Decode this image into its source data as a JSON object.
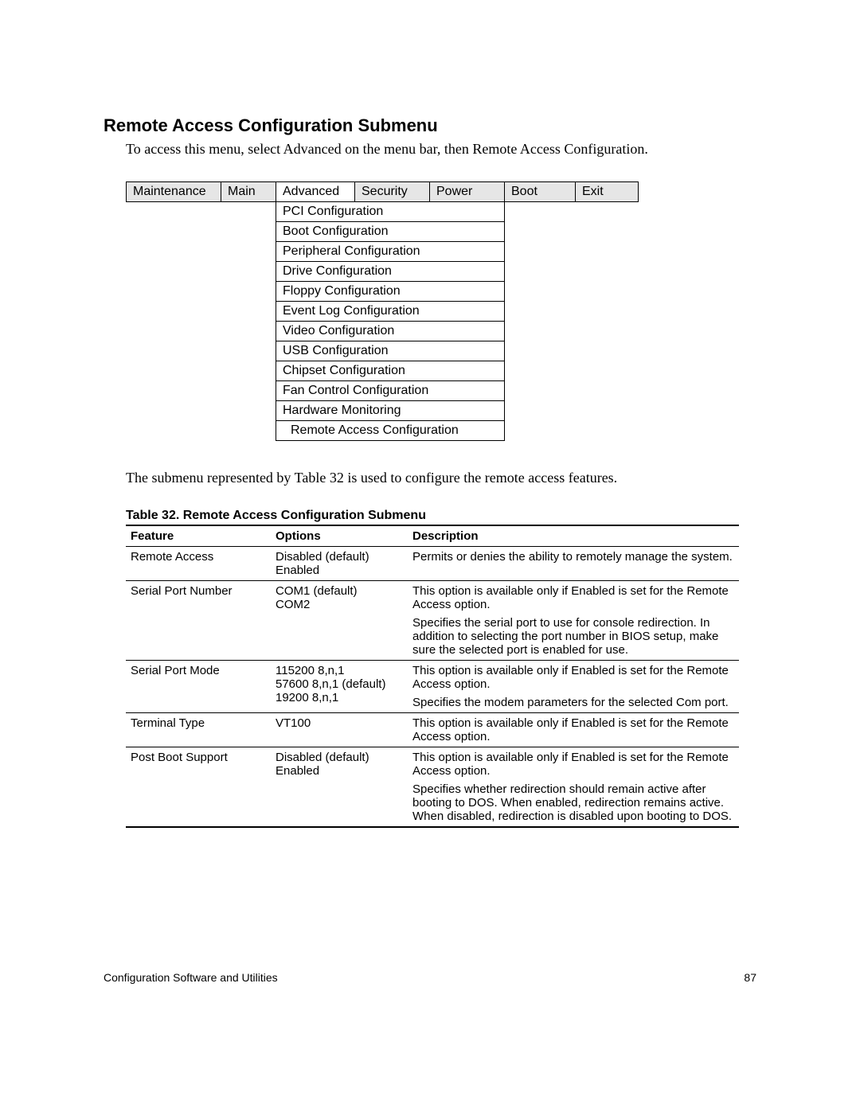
{
  "heading": "Remote Access Configuration Submenu",
  "intro": "To access this menu, select Advanced on the menu bar, then Remote Access Configuration.",
  "menu_tabs": [
    "Maintenance",
    "Main",
    "Advanced",
    "Security",
    "Power",
    "Boot",
    "Exit"
  ],
  "submenu_items": [
    "PCI Configuration",
    "Boot Configuration",
    "Peripheral Configuration",
    "Drive Configuration",
    "Floppy Configuration",
    "Event Log Configuration",
    "Video Configuration",
    "USB Configuration",
    "Chipset Configuration",
    "Fan Control Configuration",
    "Hardware Monitoring",
    "Remote Access Configuration"
  ],
  "note": "The submenu represented by Table 32 is used to configure the remote access features.",
  "table_caption": "Table 32.    Remote Access Configuration Submenu",
  "table_headers": [
    "Feature",
    "Options",
    "Description"
  ],
  "rows": [
    {
      "feature": "Remote Access",
      "options": "Disabled (default)\nEnabled",
      "description": [
        "Permits or denies the ability to remotely manage the system."
      ]
    },
    {
      "feature": "Serial Port Number",
      "options": "COM1 (default)\nCOM2",
      "description": [
        "This option is available only if Enabled is set for the Remote Access option.",
        "Specifies the serial port to use for console redirection. In addition to selecting the port number in BIOS setup, make sure the selected port is enabled for use."
      ]
    },
    {
      "feature": "Serial Port Mode",
      "options": "115200 8,n,1\n57600 8,n,1 (default)\n19200 8,n,1",
      "description": [
        "This option is available only if Enabled is set for the Remote Access option.",
        "Specifies the modem parameters for the selected Com port."
      ]
    },
    {
      "feature": "Terminal Type",
      "options": "VT100",
      "description": [
        "This option is available only if Enabled is set for the Remote Access option."
      ]
    },
    {
      "feature": "Post Boot Support",
      "options": "Disabled (default)\nEnabled",
      "description": [
        "This option is available only if Enabled is set for the Remote Access option.",
        "Specifies whether redirection should remain active after booting to DOS. When enabled, redirection remains active. When disabled, redirection is disabled upon booting to DOS."
      ]
    }
  ],
  "footer_left": "Configuration Software and Utilities",
  "footer_right": "87"
}
